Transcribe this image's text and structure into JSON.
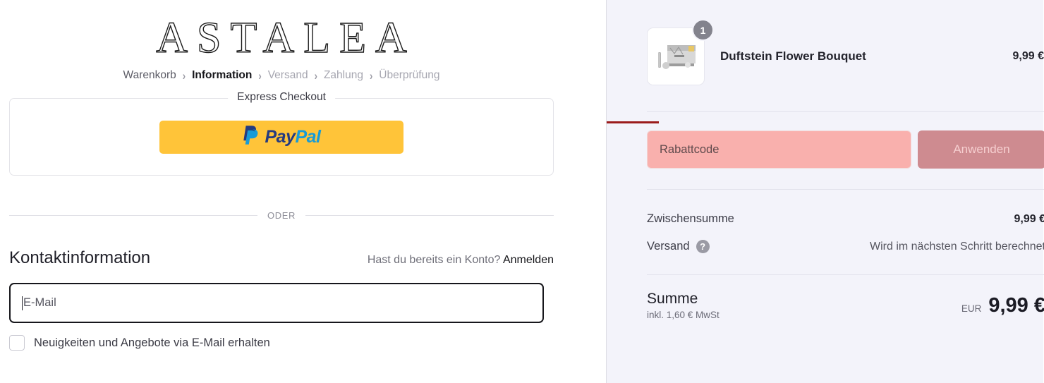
{
  "brand": {
    "logo_text": "ASTALEA"
  },
  "breadcrumb": {
    "items": [
      {
        "label": "Warenkorb",
        "state": "done"
      },
      {
        "label": "Information",
        "state": "active"
      },
      {
        "label": "Versand",
        "state": "upcoming"
      },
      {
        "label": "Zahlung",
        "state": "upcoming"
      },
      {
        "label": "Überprüfung",
        "state": "upcoming"
      }
    ],
    "separator": "›"
  },
  "express": {
    "legend": "Express Checkout",
    "paypal": {
      "pay": "Pay",
      "pal": "Pal",
      "bg_color": "#FFC439",
      "pay_color": "#253B80",
      "pal_color": "#179BD7"
    }
  },
  "divider": {
    "or_text": "ODER"
  },
  "contact": {
    "title": "Kontaktinformation",
    "account_question": "Hast du bereits ein Konto?",
    "login_link": "Anmelden",
    "email_placeholder": "E-Mail",
    "email_value": "",
    "newsletter_label": "Neuigkeiten und Angebote via E-Mail erhalten",
    "newsletter_checked": false
  },
  "summary": {
    "product": {
      "name": "Duftstein Flower Bouquet",
      "price": "9,99 €",
      "quantity": "1"
    },
    "discount": {
      "placeholder": "Rabattcode",
      "value": "",
      "apply_label": "Anwenden",
      "field_color": "#F9B0AD",
      "button_color": "#CE8B90",
      "marker_color": "#9B1B1B"
    },
    "totals": [
      {
        "label": "Zwischensumme",
        "value": "9,99 €",
        "muted": false
      },
      {
        "label": "Versand",
        "value": "Wird im nächsten Schritt berechnet",
        "muted": true,
        "help": "?"
      }
    ],
    "grand_total": {
      "label": "Summe",
      "tax_note": "inkl. 1,60 € MwSt",
      "currency": "EUR",
      "amount": "9,99 €"
    }
  }
}
